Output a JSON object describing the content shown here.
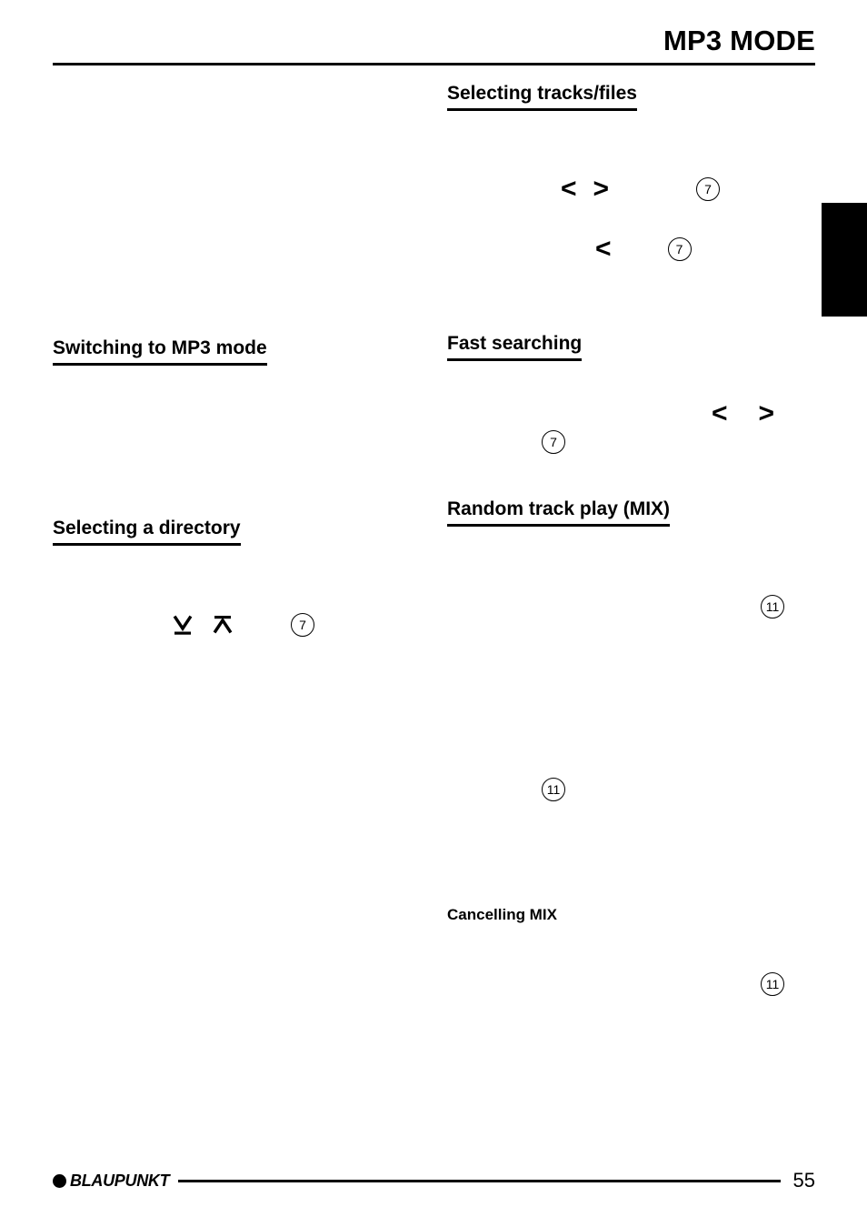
{
  "header": {
    "title": "MP3 MODE"
  },
  "chapter_tab": {
    "label": ""
  },
  "left_column": {
    "sections": [
      {
        "heading": "Switching to MP3 mode"
      },
      {
        "heading": "Selecting a directory"
      }
    ],
    "directory_controls": {
      "down_arrow_icon": "arrow-down-to-bar-icon",
      "up_arrow_icon": "arrow-up-to-bar-icon",
      "reference": "7"
    }
  },
  "right_column": {
    "sections": [
      {
        "heading": "Selecting tracks/files"
      },
      {
        "heading": "Fast searching"
      },
      {
        "heading": "Random track play (MIX)"
      }
    ],
    "sub_headings": [
      {
        "label": "Cancelling MIX"
      }
    ],
    "track_controls": {
      "left_chevron": "<",
      "right_chevron": ">",
      "reference": "7"
    },
    "track_controls_single": {
      "left_chevron": "<",
      "reference": "7"
    },
    "search_controls": {
      "reference": "7",
      "left_chevron": "<",
      "right_chevron": ">"
    },
    "mix_references": {
      "first": "11",
      "second": "11",
      "third": "11"
    }
  },
  "footer": {
    "brand": "BLAUPUNKT",
    "page_number": "55"
  }
}
